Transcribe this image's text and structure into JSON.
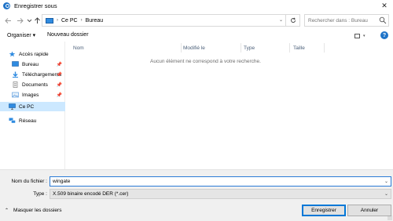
{
  "window": {
    "title": "Enregistrer sous",
    "close_label": "✕"
  },
  "nav": {
    "back_icon": "arrow-left-icon",
    "forward_icon": "arrow-right-icon",
    "recent_icon": "chevron-down-icon",
    "up_icon": "arrow-up-icon",
    "breadcrumbs": [
      "Ce PC",
      "Bureau"
    ],
    "refresh_icon": "refresh-icon"
  },
  "search": {
    "placeholder": "Rechercher dans : Bureau"
  },
  "toolbar": {
    "organize_label": "Organiser ▾",
    "new_folder_label": "Nouveau dossier",
    "help_label": "?"
  },
  "sidebar": {
    "items": [
      {
        "label": "Accès rapide"
      },
      {
        "label": "Bureau"
      },
      {
        "label": "Téléchargements"
      },
      {
        "label": "Documents"
      },
      {
        "label": "Images"
      },
      {
        "label": "Ce PC"
      },
      {
        "label": "Réseau"
      }
    ]
  },
  "columns": [
    "Nom",
    "Modifié le",
    "Type",
    "Taille"
  ],
  "empty_message": "Aucun élément ne correspond à votre recherche.",
  "form": {
    "filename_label": "Nom du fichier :",
    "filename_value": "wingate",
    "type_label": "Type :",
    "type_value": "X.509 binaire encodé DER (*.cer)"
  },
  "footer": {
    "hide_folders_label": "Masquer les dossiers",
    "save_label": "Enregistrer",
    "cancel_label": "Annuler"
  },
  "colors": {
    "accent": "#0078d7",
    "selected_bg": "#cce8ff"
  }
}
